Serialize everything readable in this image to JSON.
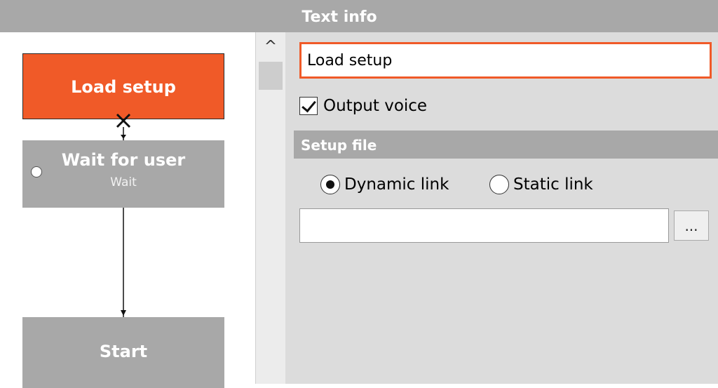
{
  "header": {
    "title": "Text info"
  },
  "flow": {
    "nodes": [
      {
        "title": "Load setup",
        "subtitle": ""
      },
      {
        "title": "Wait for user",
        "subtitle": "Wait"
      },
      {
        "title": "Start",
        "subtitle": ""
      }
    ],
    "active_color": "#f05a28",
    "node_color": "#a8a8a8"
  },
  "scrollbar": {
    "up_glyph": "^"
  },
  "props": {
    "text_value": "Load setup",
    "output_voice_label": "Output voice",
    "output_voice_checked": true,
    "section_title": "Setup file",
    "radio_dynamic_label": "Dynamic link",
    "radio_static_label": "Static link",
    "selected_link": "Dynamic link",
    "file_path_value": "",
    "browse_label": "..."
  }
}
